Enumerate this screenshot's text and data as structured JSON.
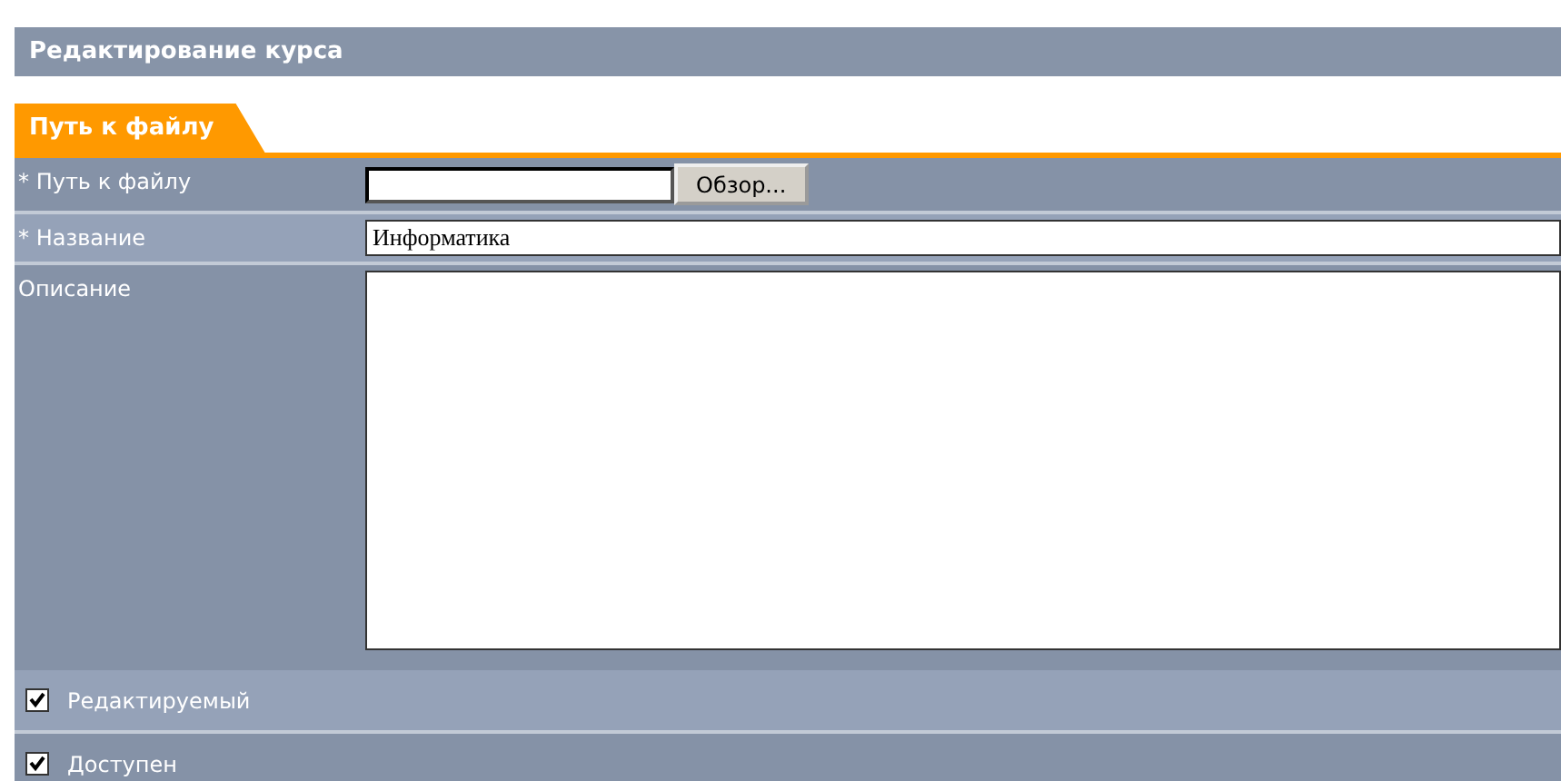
{
  "header": {
    "title": "Редактирование курса"
  },
  "tabs": [
    {
      "label": "Путь к файлу",
      "selected": true
    }
  ],
  "fields": [
    {
      "kind": "file",
      "label": "* Путь к файлу",
      "button": "Обзор..."
    },
    {
      "kind": "text",
      "label": "* Название",
      "value": "Информатика"
    },
    {
      "kind": "textarea",
      "label": "Описание"
    },
    {
      "kind": "checkbox",
      "label": "Редактируемый",
      "checked": true
    },
    {
      "kind": "checkbox",
      "label": "Доступен",
      "checked": true
    }
  ]
}
